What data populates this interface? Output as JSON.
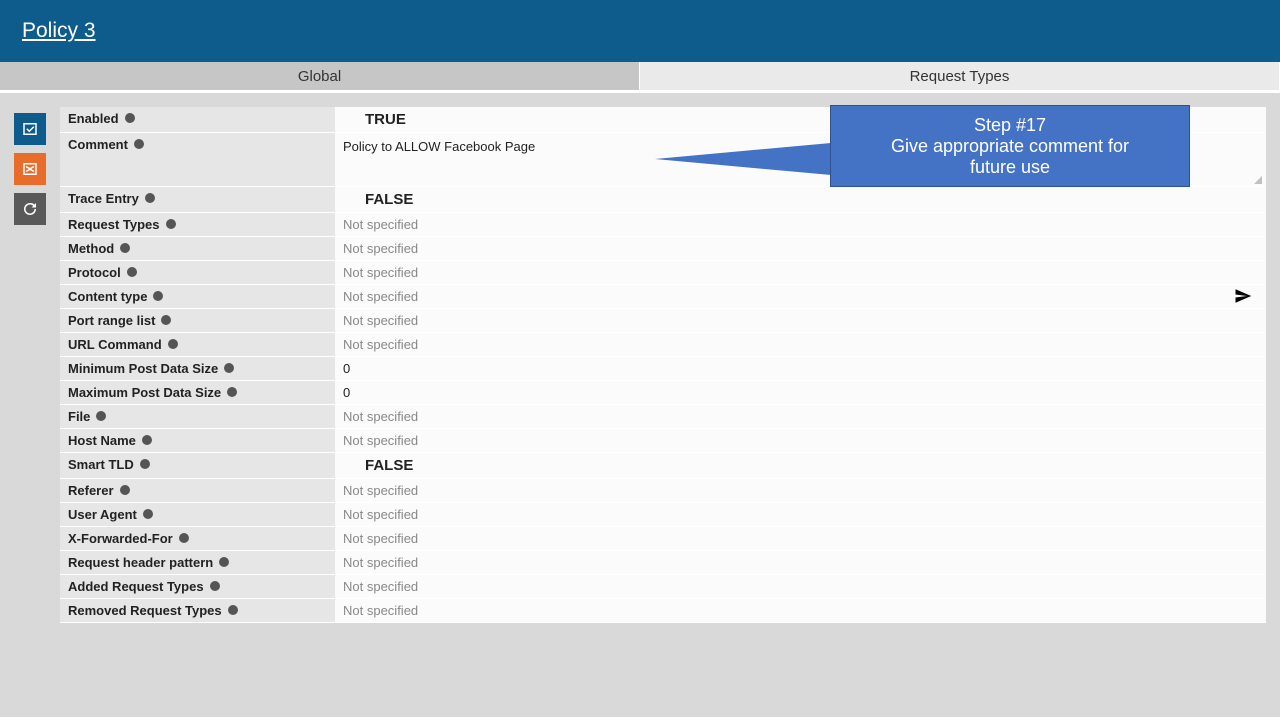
{
  "header": {
    "title": "Policy 3"
  },
  "tabs": {
    "global": "Global",
    "request_types": "Request Types"
  },
  "callout": {
    "line1": "Step #17",
    "line2": "Give appropriate comment for",
    "line3": "future use"
  },
  "rail": {
    "confirm": "confirm",
    "cancel": "cancel",
    "undo": "undo"
  },
  "fields": {
    "enabled": {
      "label": "Enabled",
      "value": "TRUE",
      "style": "big"
    },
    "comment": {
      "label": "Comment",
      "value": "Policy to ALLOW Facebook Page",
      "style": "text",
      "tall": true
    },
    "trace_entry": {
      "label": "Trace Entry",
      "value": "FALSE",
      "style": "big"
    },
    "request_types": {
      "label": "Request Types",
      "value": "Not specified",
      "style": "grey"
    },
    "method": {
      "label": "Method",
      "value": "Not specified",
      "style": "grey"
    },
    "protocol": {
      "label": "Protocol",
      "value": "Not specified",
      "style": "grey"
    },
    "content_type": {
      "label": "Content type",
      "value": "Not specified",
      "style": "grey",
      "send": true
    },
    "port_range_list": {
      "label": "Port range list",
      "value": "Not specified",
      "style": "grey"
    },
    "url_command": {
      "label": "URL Command",
      "value": "Not specified",
      "style": "grey"
    },
    "min_post": {
      "label": "Minimum Post Data Size",
      "value": "0",
      "style": "text"
    },
    "max_post": {
      "label": "Maximum Post Data Size",
      "value": "0",
      "style": "text"
    },
    "file": {
      "label": "File",
      "value": "Not specified",
      "style": "grey"
    },
    "host_name": {
      "label": "Host Name",
      "value": "Not specified",
      "style": "grey"
    },
    "smart_tld": {
      "label": "Smart TLD",
      "value": "FALSE",
      "style": "big"
    },
    "referer": {
      "label": "Referer",
      "value": "Not specified",
      "style": "grey"
    },
    "user_agent": {
      "label": "User Agent",
      "value": "Not specified",
      "style": "grey"
    },
    "x_forwarded_for": {
      "label": "X-Forwarded-For",
      "value": "Not specified",
      "style": "grey"
    },
    "req_header_pattern": {
      "label": "Request header pattern",
      "value": "Not specified",
      "style": "grey"
    },
    "added_req_types": {
      "label": "Added Request Types",
      "value": "Not specified",
      "style": "grey"
    },
    "removed_req_types": {
      "label": "Removed Request Types",
      "value": "Not specified",
      "style": "grey"
    }
  },
  "field_order": [
    "enabled",
    "comment",
    "trace_entry",
    "request_types",
    "method",
    "protocol",
    "content_type",
    "port_range_list",
    "url_command",
    "min_post",
    "max_post",
    "file",
    "host_name",
    "smart_tld",
    "referer",
    "user_agent",
    "x_forwarded_for",
    "req_header_pattern",
    "added_req_types",
    "removed_req_types"
  ]
}
